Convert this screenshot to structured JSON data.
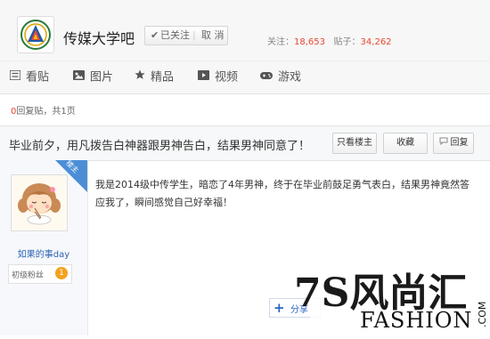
{
  "header": {
    "forum_name": "传媒大学吧",
    "follow_label": "已关注",
    "unfollow_label": "取 消",
    "followers_label": "关注：",
    "followers_count": "18,653",
    "posts_label": "贴子：",
    "posts_count": "34,262"
  },
  "nav": {
    "items": [
      {
        "label": "看贴",
        "icon": "list-icon"
      },
      {
        "label": "图片",
        "icon": "image-icon"
      },
      {
        "label": "精品",
        "icon": "star-icon"
      },
      {
        "label": "视频",
        "icon": "video-icon"
      },
      {
        "label": "游戏",
        "icon": "gamepad-icon"
      }
    ]
  },
  "page_info": {
    "reply_count": "0",
    "reply_text": "回复贴，共1页"
  },
  "thread": {
    "title": "毕业前夕，用凡拨告白神器跟男神告白，结果男神同意了！",
    "only_owner_label": "只看楼主",
    "favorite_label": "收藏",
    "reply_label": "回复"
  },
  "author": {
    "badge": "楼主",
    "name": "如果的事day",
    "level_title": "初级粉丝",
    "level_num": "1"
  },
  "post": {
    "content": "我是2014级中传学生，暗恋了4年男神，终于在毕业前鼓足勇气表白，结果男神竟然答应我了，瞬间感觉自己好幸福！"
  },
  "share": {
    "label": "分享"
  },
  "watermark": {
    "text_main": "7S风尚汇",
    "text_sub": "FASHION",
    "text_side": ".COM"
  },
  "colors": {
    "accent_red": "#e6462f",
    "link_blue": "#2d64b3",
    "badge_blue": "#4b8ed6",
    "level_orange": "#f3a21d"
  }
}
